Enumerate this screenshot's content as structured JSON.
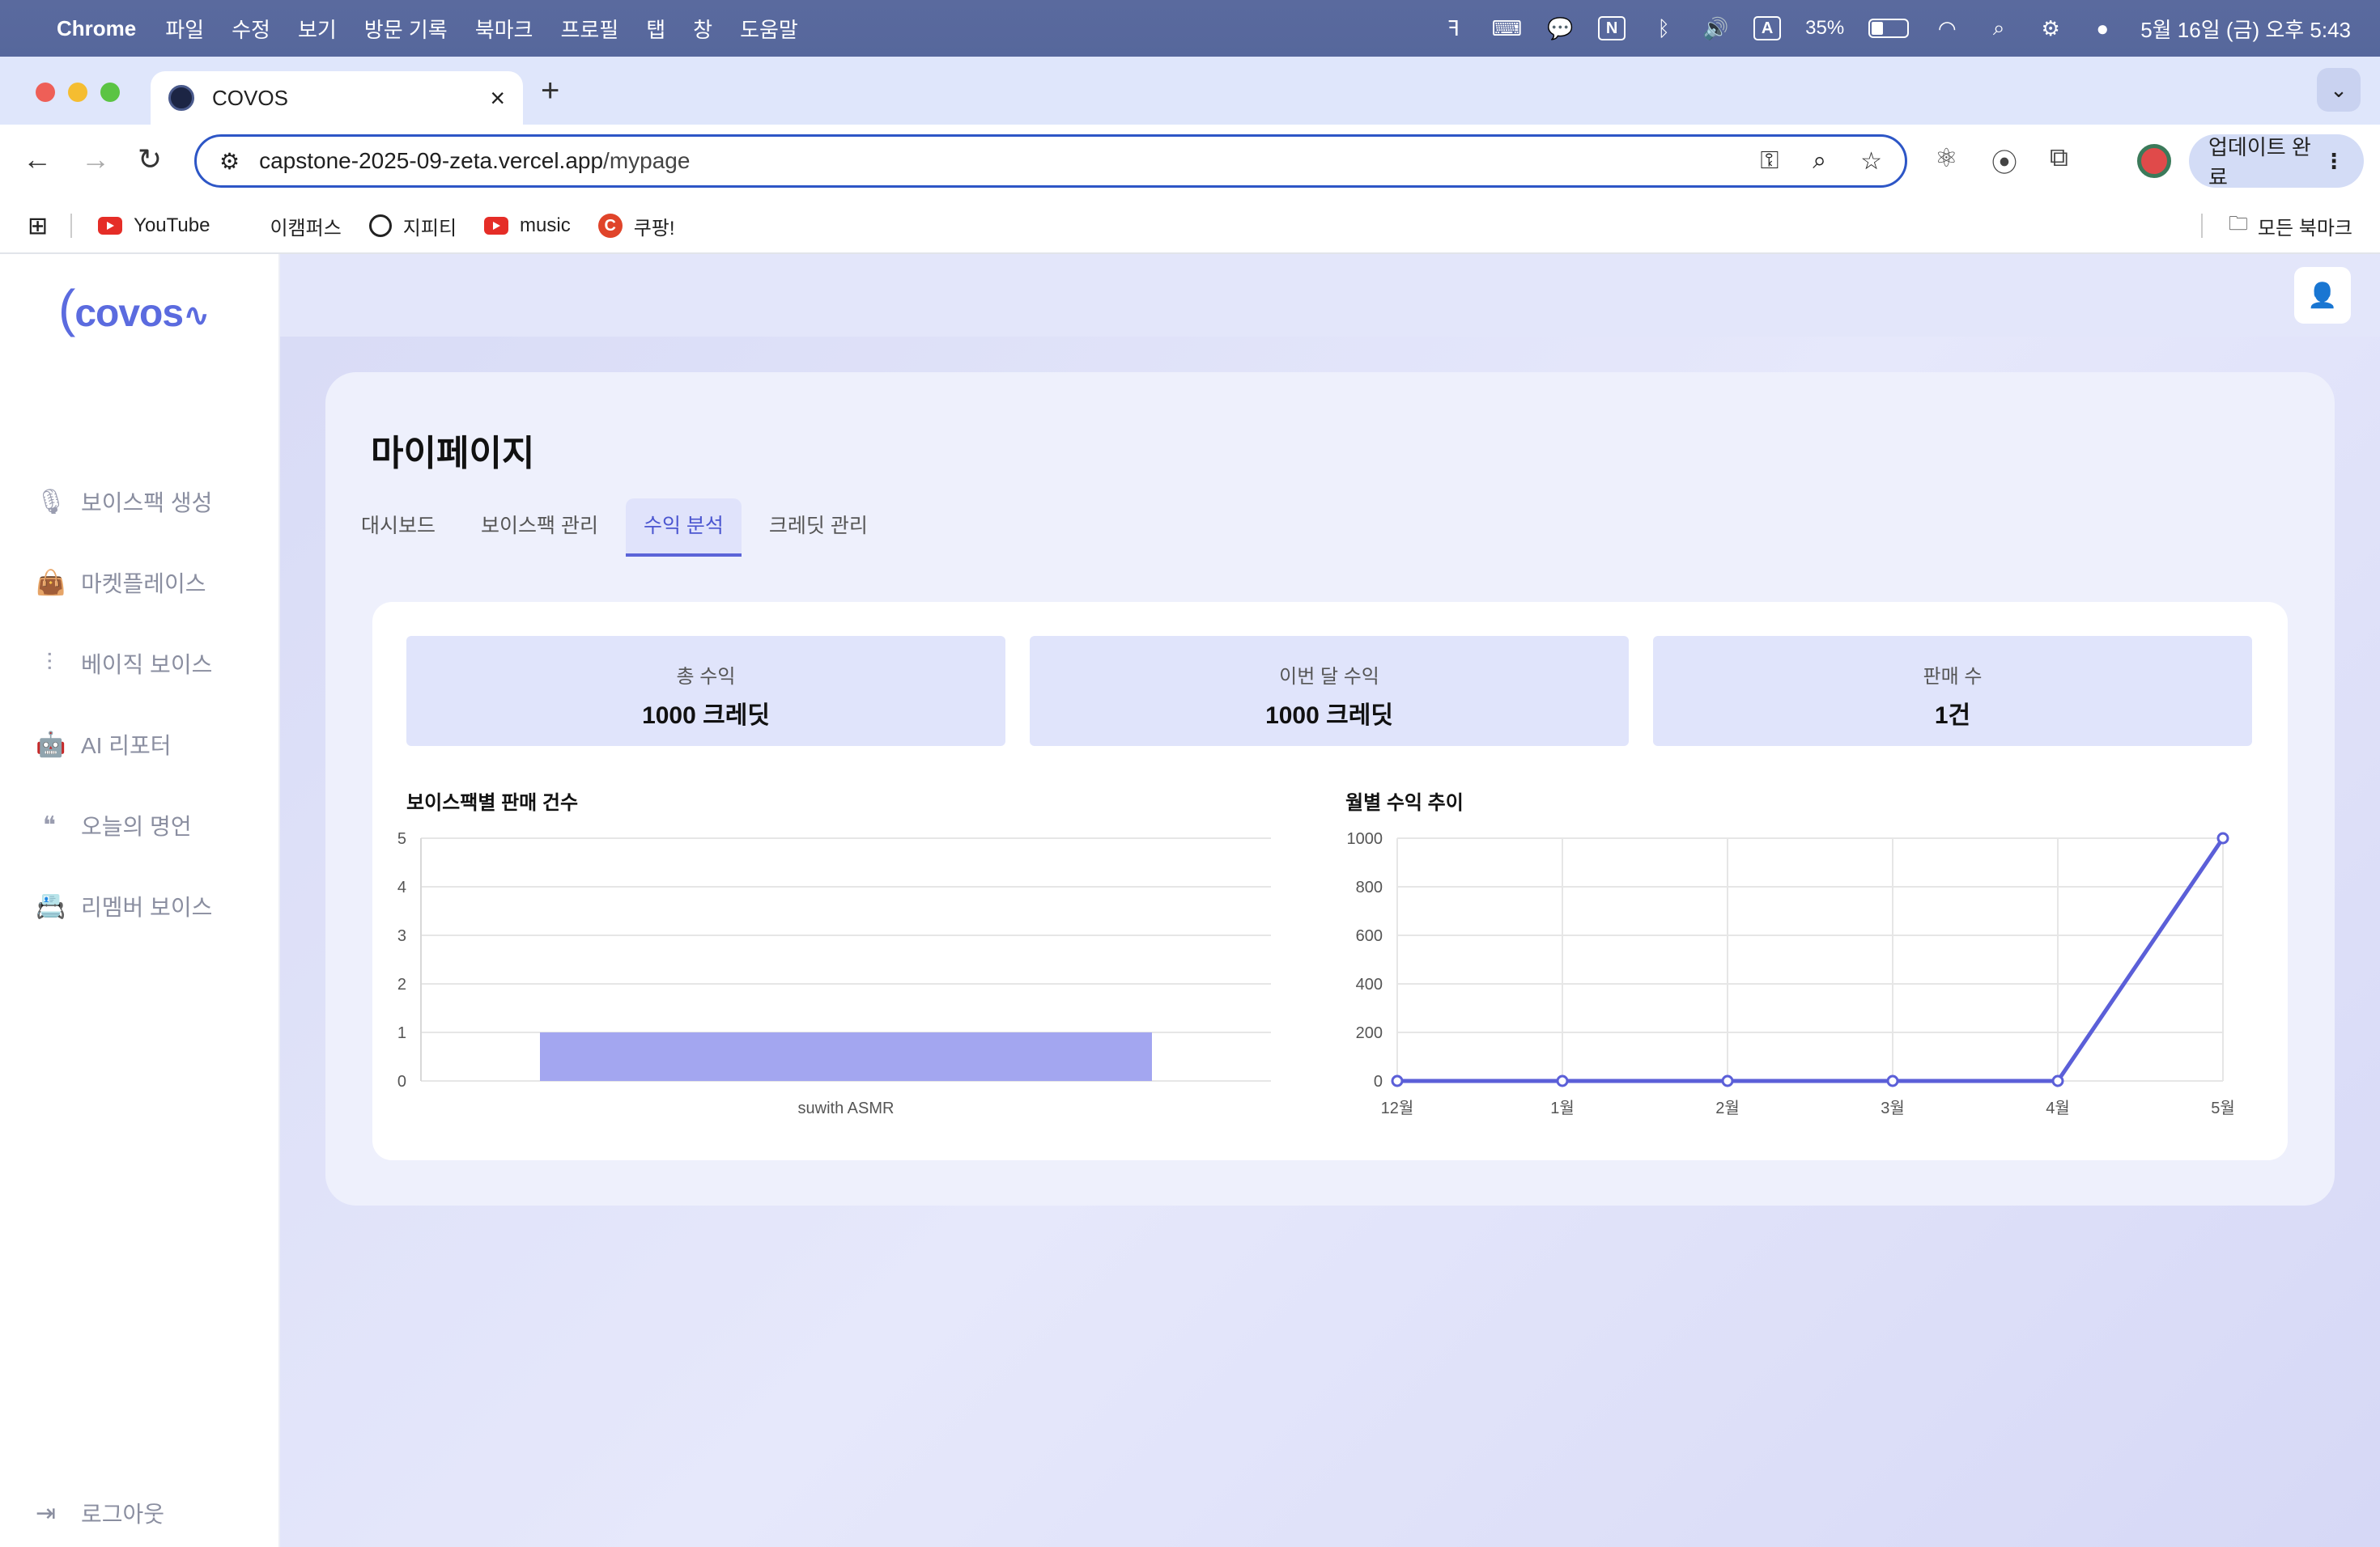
{
  "menubar": {
    "app": "Chrome",
    "menus": [
      "파일",
      "수정",
      "보기",
      "방문 기록",
      "북마크",
      "프로필",
      "탭",
      "창",
      "도움말"
    ],
    "battery": "35%",
    "datetime": "5월 16일 (금) 오후 5:43",
    "input_indicator": "A"
  },
  "browser": {
    "tab_title": "COVOS",
    "url_host": "capstone-2025-09-zeta.vercel.app",
    "url_path": "/mypage",
    "update_label": "업데이트 완료",
    "bookmarks": [
      "YouTube",
      "이캠퍼스",
      "지피티",
      "music",
      "쿠팡!"
    ],
    "all_bookmarks": "모든 북마크"
  },
  "sidebar": {
    "logo": "covos",
    "items": [
      {
        "label": "보이스팩 생성",
        "icon": "microphone-icon"
      },
      {
        "label": "마켓플레이스",
        "icon": "shopping-bag-icon"
      },
      {
        "label": "베이직 보이스",
        "icon": "waveform-icon"
      },
      {
        "label": "AI 리포터",
        "icon": "robot-icon"
      },
      {
        "label": "오늘의 명언",
        "icon": "quote-icon"
      },
      {
        "label": "리멤버 보이스",
        "icon": "contact-book-icon"
      }
    ],
    "logout": "로그아웃"
  },
  "page": {
    "title": "마이페이지",
    "tabs": [
      "대시보드",
      "보이스팩 관리",
      "수익 분석",
      "크레딧 관리"
    ],
    "active_tab": "수익 분석"
  },
  "stats": [
    {
      "label": "총 수익",
      "value": "1000 크레딧"
    },
    {
      "label": "이번 달 수익",
      "value": "1000 크레딧"
    },
    {
      "label": "판매 수",
      "value": "1건"
    }
  ],
  "colors": {
    "accent": "#5b64d8",
    "bar": "#a3a6f0",
    "line": "#5b5fd8"
  },
  "chart_data": [
    {
      "type": "bar",
      "title": "보이스팩별 판매 건수",
      "categories": [
        "suwith ASMR"
      ],
      "values": [
        1
      ],
      "ylim": [
        0,
        5
      ],
      "yticks": [
        0,
        1,
        2,
        3,
        4,
        5
      ],
      "grid": true
    },
    {
      "type": "line",
      "title": "월별 수익 추이",
      "categories": [
        "12월",
        "1월",
        "2월",
        "3월",
        "4월",
        "5월"
      ],
      "values": [
        0,
        0,
        0,
        0,
        0,
        1000
      ],
      "ylim": [
        0,
        1000
      ],
      "yticks": [
        0,
        200,
        400,
        600,
        800,
        1000
      ],
      "grid": true
    }
  ]
}
